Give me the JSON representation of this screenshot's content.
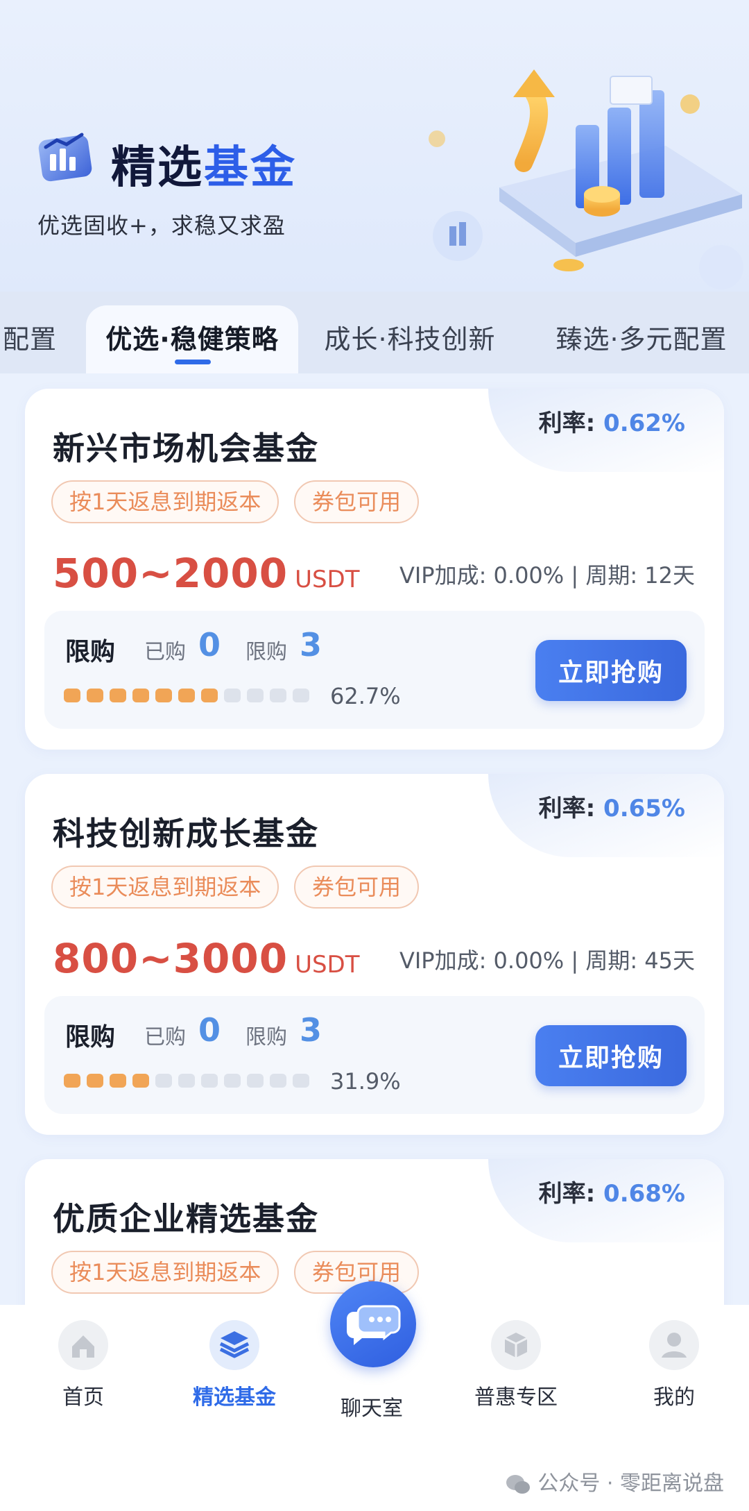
{
  "header": {
    "title_part1": "精选",
    "title_part2": "基金",
    "subtitle": "优选固收+，求稳又求盈"
  },
  "tabs": [
    {
      "label": "配置"
    },
    {
      "label": "优选·稳健策略",
      "active": true
    },
    {
      "label": "成长·科技创新"
    },
    {
      "label": "臻选·多元配置"
    }
  ],
  "funds": [
    {
      "name": "新兴市场机会基金",
      "rate_label": "利率:",
      "rate": "0.62%",
      "tags": [
        "按1天返息到期返本",
        "券包可用"
      ],
      "amount": "500~2000",
      "unit": "USDT",
      "meta": "VIP加成: 0.00% | 周期: 12天",
      "limit_title": "限购",
      "bought_label": "已购",
      "bought": "0",
      "limit_label": "限购",
      "limit": "3",
      "progress": 62.7,
      "progress_text": "62.7%",
      "buy_label": "立即抢购"
    },
    {
      "name": "科技创新成长基金",
      "rate_label": "利率:",
      "rate": "0.65%",
      "tags": [
        "按1天返息到期返本",
        "券包可用"
      ],
      "amount": "800~3000",
      "unit": "USDT",
      "meta": "VIP加成: 0.00% | 周期: 45天",
      "limit_title": "限购",
      "bought_label": "已购",
      "bought": "0",
      "limit_label": "限购",
      "limit": "3",
      "progress": 31.9,
      "progress_text": "31.9%",
      "buy_label": "立即抢购"
    },
    {
      "name": "优质企业精选基金",
      "rate_label": "利率:",
      "rate": "0.68%",
      "tags": [
        "按1天返息到期返本",
        "券包可用"
      ]
    }
  ],
  "nav": [
    {
      "label": "首页",
      "icon": "home-icon"
    },
    {
      "label": "精选基金",
      "icon": "stack-icon",
      "active": true
    },
    {
      "label": "聊天室",
      "icon": "chat-icon"
    },
    {
      "label": "普惠专区",
      "icon": "box-icon"
    },
    {
      "label": "我的",
      "icon": "user-icon"
    }
  ],
  "watermark": "公众号 · 零距离说盘",
  "colors": {
    "accent": "#2f6be8",
    "amount_red": "#d84f43",
    "tag_orange": "#ea8c5a",
    "progress_on": "#f1a556",
    "rate_blue": "#4f86e6"
  }
}
